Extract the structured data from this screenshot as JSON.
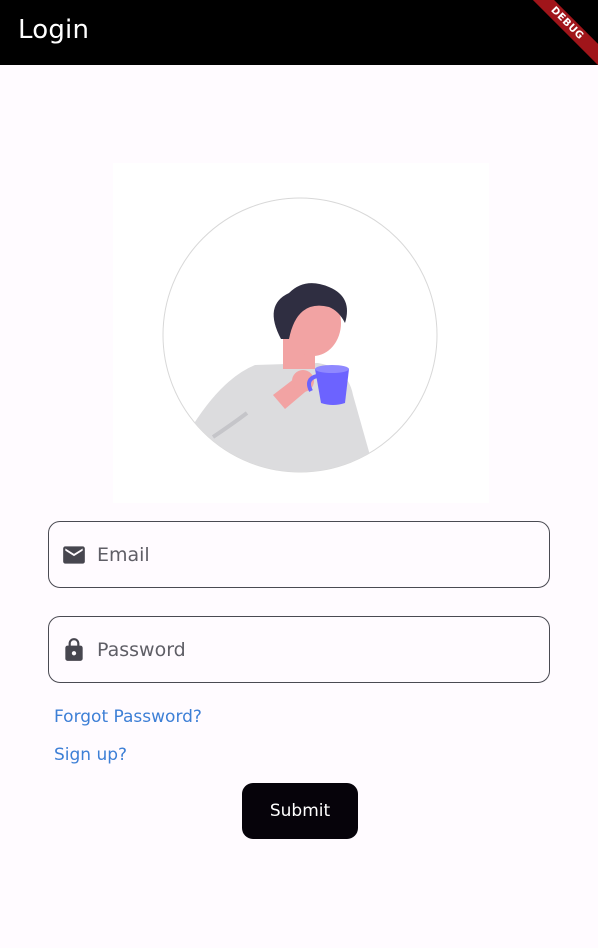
{
  "appbar": {
    "title": "Login",
    "debug_label": "DEBUG"
  },
  "form": {
    "email": {
      "placeholder": "Email",
      "value": "",
      "icon": "mail-icon"
    },
    "password": {
      "placeholder": "Password",
      "value": "",
      "icon": "lock-icon"
    },
    "forgot_label": "Forgot Password?",
    "signup_label": "Sign up?",
    "submit_label": "Submit"
  },
  "colors": {
    "appbar": "#000000",
    "background": "#fffbff",
    "link": "#3d7fd6",
    "button": "#06030a",
    "debug": "#a0151a",
    "mug": "#6c63ff"
  }
}
